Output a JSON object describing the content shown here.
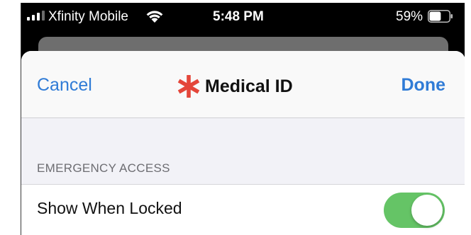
{
  "status_bar": {
    "carrier": "Xfinity Mobile",
    "time": "5:48 PM",
    "battery_percent": "59%",
    "battery_level": 0.59,
    "signal_bars_active": 3,
    "signal_bars_total": 4,
    "icons": [
      "signal-icon",
      "wifi-icon",
      "battery-icon"
    ]
  },
  "nav": {
    "cancel_label": "Cancel",
    "title": "Medical ID",
    "done_label": "Done",
    "title_icon": "asterisk-icon"
  },
  "section": {
    "header": "EMERGENCY ACCESS",
    "rows": [
      {
        "label": "Show When Locked",
        "toggle_on": true
      }
    ]
  },
  "colors": {
    "accent_blue": "#2f7bd6",
    "medical_red": "#e4463a",
    "toggle_green": "#65c466",
    "sheet_background": "#f2f2f7"
  }
}
